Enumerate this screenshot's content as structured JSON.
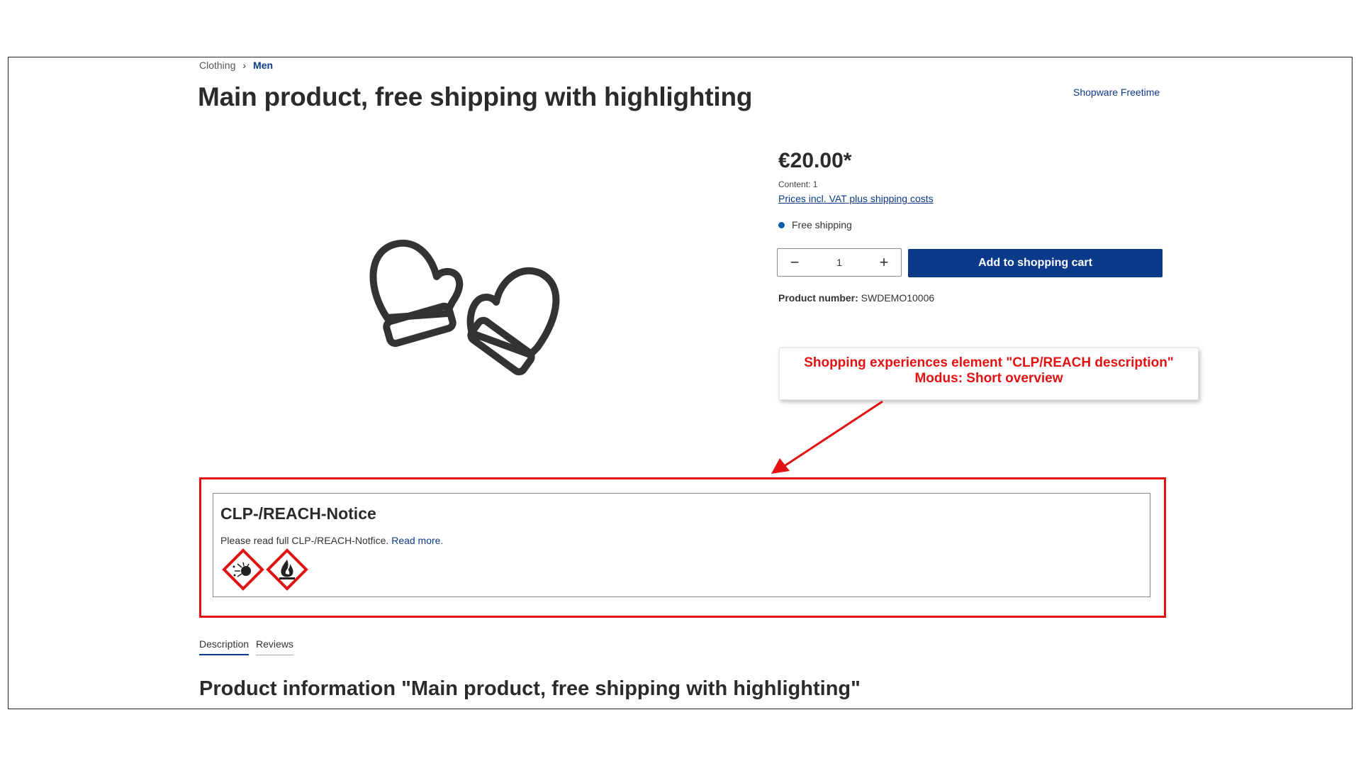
{
  "breadcrumb": {
    "items": [
      "Clothing",
      "Men"
    ],
    "separator": "›"
  },
  "product": {
    "title": "Main product, free shipping with highlighting",
    "manufacturer": "Shopware Freetime",
    "price": "€20.00*",
    "content": "Content: 1",
    "price_note_link": "Prices incl. VAT plus shipping costs",
    "shipping": "Free shipping",
    "quantity": "1",
    "add_to_cart": "Add to shopping cart",
    "product_number_label": "Product number:",
    "product_number": "SWDEMO10006",
    "image_icon": "mittens-icon"
  },
  "annotation": {
    "line1": "Shopping experiences element \"CLP/REACH description\"",
    "line2": "Modus: Short overview",
    "color": "#e31212"
  },
  "clp": {
    "title": "CLP-/REACH-Notice",
    "text": "Please read full CLP-/REACH-Notfice.",
    "read_more": "Read more.",
    "pictograms": [
      "ghs-explosive-icon",
      "ghs-flammable-icon"
    ]
  },
  "tabs": [
    {
      "label": "Description",
      "active": true
    },
    {
      "label": "Reviews",
      "active": false
    }
  ],
  "info_title": "Product information \"Main product, free shipping with highlighting\"",
  "colors": {
    "brand": "#0b3a8a",
    "text": "#2b2b2b",
    "highlight": "#e31212"
  }
}
